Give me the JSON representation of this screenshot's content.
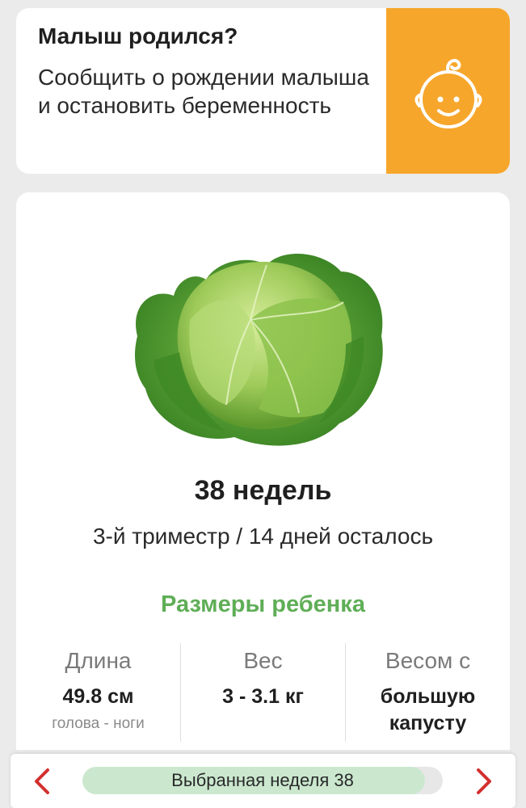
{
  "birth_card": {
    "title": "Малыш родился?",
    "description": "Сообщить о рождении малыша и остановить беременность",
    "icon": "baby-face-icon",
    "accent_color": "#F7A62C"
  },
  "week_info": {
    "image": "cabbage-image",
    "week_title": "38 недель",
    "subtitle": "3-й триместр / 14 дней осталось"
  },
  "sizes": {
    "heading": "Размеры ребенка",
    "heading_color": "#5FAE57",
    "length": {
      "label": "Длина",
      "value": "49.8 см",
      "note": "голова - ноги"
    },
    "weight": {
      "label": "Вес",
      "value": "3 - 3.1 кг"
    },
    "comparison": {
      "label": "Весом с",
      "value_line1": "большую",
      "value_line2": "капусту"
    }
  },
  "week_selector": {
    "label": "Выбранная неделя 38",
    "selected_week": 38,
    "progress_fraction": 0.95,
    "prev_icon": "chevron-left-icon",
    "next_icon": "chevron-right-icon",
    "arrow_color": "#D32F2F"
  }
}
